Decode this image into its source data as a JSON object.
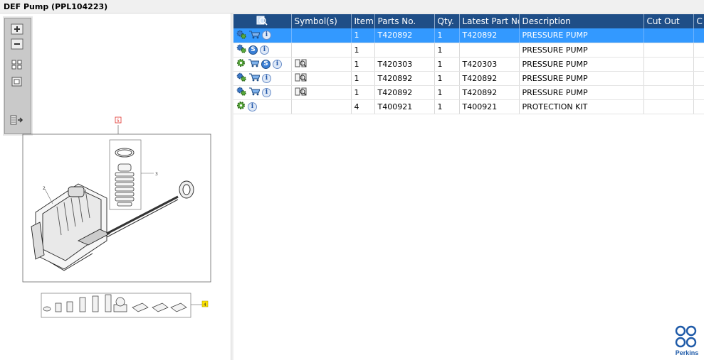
{
  "window": {
    "title": "DEF Pump (PPL104223)"
  },
  "diagram": {
    "callouts": [
      "5",
      "3",
      "2",
      "4"
    ]
  },
  "table": {
    "columns": [
      "Symbol(s)",
      "Item",
      "Parts No.",
      "Qty.",
      "Latest Part No.",
      "Description",
      "Cut Out",
      "C"
    ],
    "rows": [
      {
        "icons": [
          "gear-cart-icon",
          "cart-icon",
          "info-icon"
        ],
        "symbol": false,
        "item": "1",
        "parts_no": "T420892",
        "qty": "1",
        "latest": "T420892",
        "desc": "PRESSURE PUMP",
        "selected": true
      },
      {
        "icons": [
          "gears-icon",
          "s-icon",
          "info-icon"
        ],
        "symbol": false,
        "item": "1",
        "parts_no": "",
        "qty": "1",
        "latest": "",
        "desc": "PRESSURE PUMP",
        "selected": false
      },
      {
        "icons": [
          "gear-icon",
          "cart-icon",
          "s-icon",
          "info-icon"
        ],
        "symbol": true,
        "item": "1",
        "parts_no": "T420303",
        "qty": "1",
        "latest": "T420303",
        "desc": "PRESSURE PUMP",
        "selected": false
      },
      {
        "icons": [
          "gears-icon",
          "cart-icon",
          "info-icon"
        ],
        "symbol": true,
        "item": "1",
        "parts_no": "T420892",
        "qty": "1",
        "latest": "T420892",
        "desc": "PRESSURE PUMP",
        "selected": false
      },
      {
        "icons": [
          "gears-icon",
          "cart-icon",
          "info-icon"
        ],
        "symbol": true,
        "item": "1",
        "parts_no": "T420892",
        "qty": "1",
        "latest": "T420892",
        "desc": "PRESSURE PUMP",
        "selected": false
      },
      {
        "icons": [
          "gear-icon",
          "info-icon"
        ],
        "symbol": false,
        "item": "4",
        "parts_no": "T400921",
        "qty": "1",
        "latest": "T400921",
        "desc": "PROTECTION KIT",
        "selected": false
      }
    ]
  },
  "brand": {
    "name": "Perkins",
    "color": "#1e5aa8"
  },
  "colors": {
    "header": "#1f4e87",
    "selected": "#3399ff"
  }
}
